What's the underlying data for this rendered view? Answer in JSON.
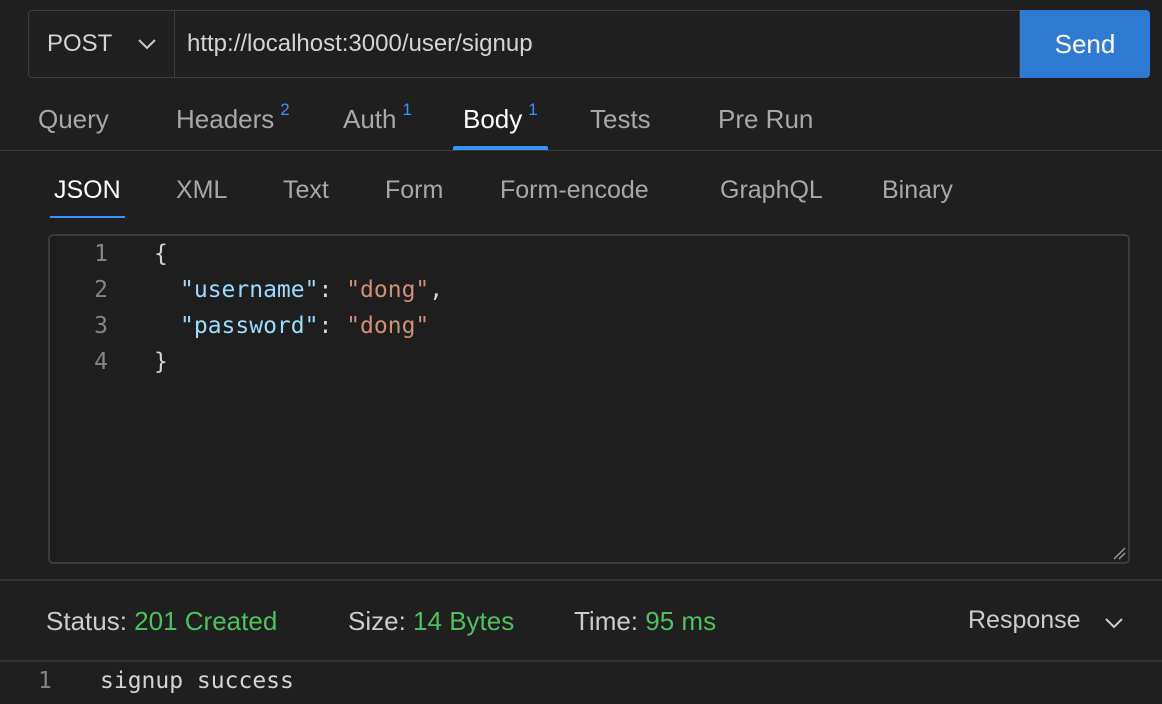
{
  "request": {
    "method": "POST",
    "url": "http://localhost:3000/user/signup",
    "send_label": "Send"
  },
  "tabs": [
    {
      "label": "Query",
      "badge": ""
    },
    {
      "label": "Headers",
      "badge": "2"
    },
    {
      "label": "Auth",
      "badge": "1"
    },
    {
      "label": "Body",
      "badge": "1",
      "active": true
    },
    {
      "label": "Tests",
      "badge": ""
    },
    {
      "label": "Pre Run",
      "badge": ""
    }
  ],
  "body_tabs": [
    {
      "label": "JSON",
      "active": true
    },
    {
      "label": "XML"
    },
    {
      "label": "Text"
    },
    {
      "label": "Form"
    },
    {
      "label": "Form-encode"
    },
    {
      "label": "GraphQL"
    },
    {
      "label": "Binary"
    }
  ],
  "editor": {
    "lines": [
      {
        "n": "1",
        "open": "{"
      },
      {
        "n": "2",
        "key": "\"username\"",
        "colon": ": ",
        "value": "\"dong\"",
        "trail": ","
      },
      {
        "n": "3",
        "key": "\"password\"",
        "colon": ": ",
        "value": "\"dong\"",
        "trail": ""
      },
      {
        "n": "4",
        "close": "}"
      }
    ]
  },
  "status": {
    "status_label": "Status:",
    "status_value": "201 Created",
    "size_label": "Size:",
    "size_value": "14 Bytes",
    "time_label": "Time:",
    "time_value": "95 ms",
    "response_view": "Response"
  },
  "response": {
    "line_number": "1",
    "text": "signup success"
  },
  "colors": {
    "accent": "#3794ff",
    "send_button": "#2f7ad2",
    "success": "#4ec05d",
    "background": "#1f1f1f"
  }
}
